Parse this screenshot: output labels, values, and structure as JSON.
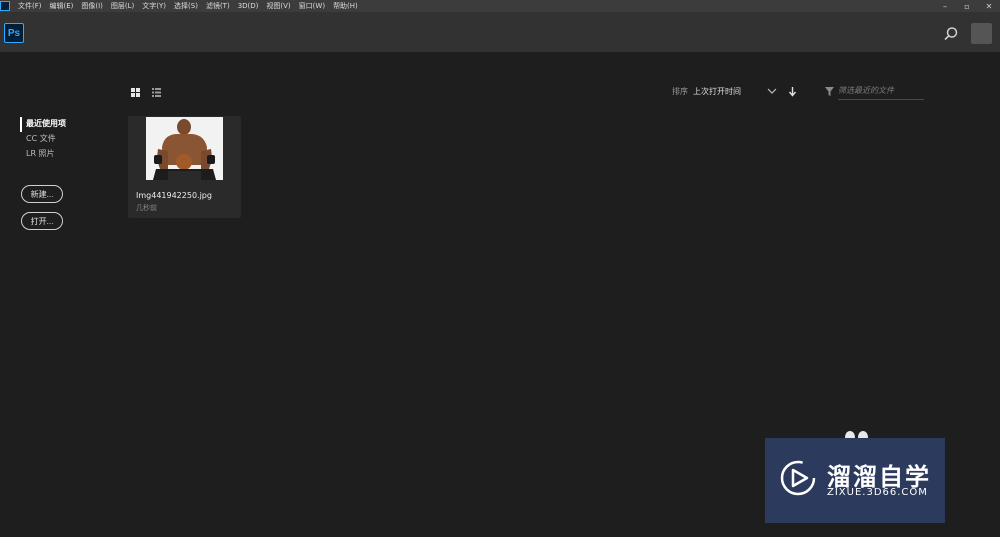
{
  "menubar": {
    "items": [
      "文件(F)",
      "编辑(E)",
      "图像(I)",
      "图层(L)",
      "文字(Y)",
      "选择(S)",
      "滤镜(T)",
      "3D(D)",
      "视图(V)",
      "窗口(W)",
      "帮助(H)"
    ],
    "window_controls": [
      "–",
      "▫",
      "✕"
    ]
  },
  "header": {
    "logo": "Ps",
    "accent_color": "#31a8ff"
  },
  "sidebar": {
    "items": [
      {
        "label": "最近使用项",
        "active": true
      },
      {
        "label": "CC 文件",
        "active": false
      },
      {
        "label": "LR 照片",
        "active": false
      }
    ],
    "new_button": "新建...",
    "open_button": "打开..."
  },
  "toolbar": {
    "sort_label": "排序",
    "sort_value": "上次打开时间",
    "filter_placeholder": "筛选最近的文件"
  },
  "files": [
    {
      "name": "Img441942250.jpg",
      "time": "几秒前"
    }
  ],
  "watermark": {
    "title": "溜溜自学",
    "url": "ZIXUE.3D66.COM",
    "bg_color": "#2c3a5e"
  }
}
